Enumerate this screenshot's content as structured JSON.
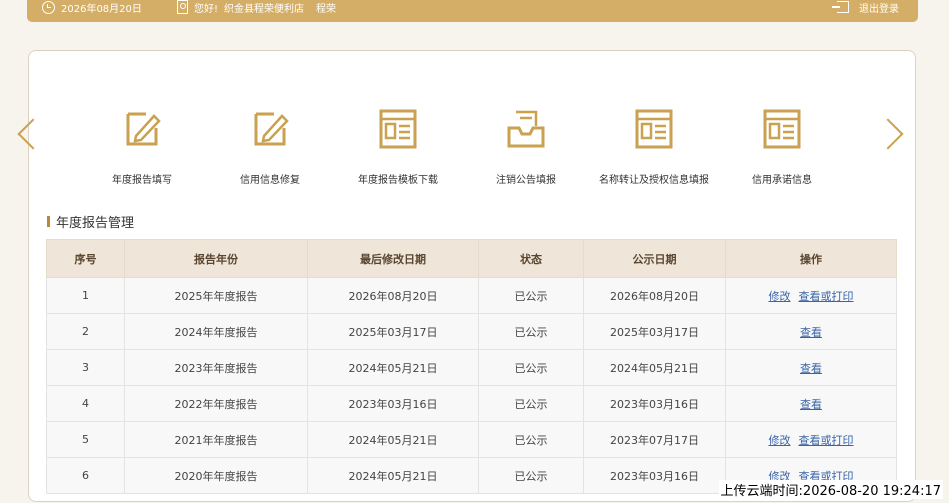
{
  "header": {
    "date": "2026年08月20日",
    "greeting": "您好!",
    "store": "织金县程荣便利店",
    "user": "程荣",
    "logout": "退出登录"
  },
  "quick_actions": [
    {
      "label": "年度报告填写",
      "icon": "edit-document-icon"
    },
    {
      "label": "信用信息修复",
      "icon": "edit-document-icon"
    },
    {
      "label": "年度报告模板下载",
      "icon": "form-template-icon"
    },
    {
      "label": "注销公告填报",
      "icon": "inbox-tray-icon"
    },
    {
      "label": "名称转让及授权信息填报",
      "icon": "form-template-icon"
    },
    {
      "label": "信用承诺信息",
      "icon": "form-template-icon"
    }
  ],
  "section": {
    "title": "年度报告管理"
  },
  "table": {
    "headers": [
      "序号",
      "报告年份",
      "最后修改日期",
      "状态",
      "公示日期",
      "操作"
    ],
    "rows": [
      {
        "no": "1",
        "year": "2025年年度报告",
        "modified": "2026年08月20日",
        "status": "已公示",
        "published": "2026年08月20日",
        "actions": [
          "修改",
          "查看或打印"
        ]
      },
      {
        "no": "2",
        "year": "2024年年度报告",
        "modified": "2025年03月17日",
        "status": "已公示",
        "published": "2025年03月17日",
        "actions": [
          "查看"
        ]
      },
      {
        "no": "3",
        "year": "2023年年度报告",
        "modified": "2024年05月21日",
        "status": "已公示",
        "published": "2024年05月21日",
        "actions": [
          "查看"
        ]
      },
      {
        "no": "4",
        "year": "2022年年度报告",
        "modified": "2023年03月16日",
        "status": "已公示",
        "published": "2023年03月16日",
        "actions": [
          "查看"
        ]
      },
      {
        "no": "5",
        "year": "2021年年度报告",
        "modified": "2024年05月21日",
        "status": "已公示",
        "published": "2023年07月17日",
        "actions": [
          "修改",
          "查看或打印"
        ]
      },
      {
        "no": "6",
        "year": "2020年年度报告",
        "modified": "2024年05月21日",
        "status": "已公示",
        "published": "2023年03月16日",
        "actions": [
          "修改",
          "查看或打印"
        ]
      }
    ]
  },
  "footer_stamp": "上传云端时间:2026-08-20 19:24:17",
  "colors": {
    "accent": "#d4ae66",
    "icon": "#c9a14f",
    "link": "#3a64a8",
    "header_bg": "#efe5d8"
  }
}
